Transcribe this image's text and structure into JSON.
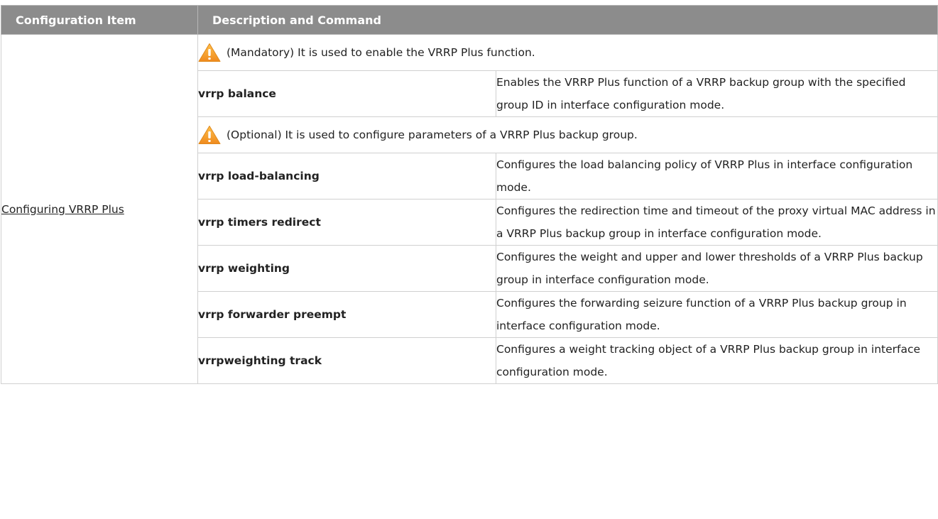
{
  "header": {
    "col1": "Configuration Item",
    "col2": "Description and Command"
  },
  "item": {
    "label": "Configuring VRRP Plus"
  },
  "notes": {
    "mandatory": "(Mandatory) It is used to enable the VRRP Plus function.",
    "optional": "(Optional) It is used to configure parameters of a VRRP Plus backup group."
  },
  "commands": [
    {
      "command": "vrrp balance",
      "description": "Enables the VRRP Plus function of a VRRP backup group with the specified group ID in interface configuration mode."
    },
    {
      "command": "vrrp load-balancing",
      "description": "Configures the load balancing policy of VRRP Plus in interface configuration mode."
    },
    {
      "command": "vrrp timers redirect",
      "description": "Configures the redirection time and timeout of the proxy virtual MAC address in a VRRP Plus backup group in interface configuration mode."
    },
    {
      "command": "vrrp weighting",
      "description": "Configures the weight and upper and lower thresholds of a VRRP Plus backup group in interface configuration mode."
    },
    {
      "command": "vrrp forwarder preempt",
      "description": "Configures the forwarding seizure function of a VRRP Plus backup group in interface configuration mode."
    },
    {
      "command": "vrrpweighting track",
      "description": "Configures a weight tracking object of a VRRP Plus backup group in interface configuration mode."
    }
  ],
  "colors": {
    "header_bg": "#8c8c8c",
    "header_text": "#ffffff",
    "border": "#d0d0d0",
    "warn_orange": "#f0a030"
  },
  "icons": {
    "note": "warning-icon"
  }
}
